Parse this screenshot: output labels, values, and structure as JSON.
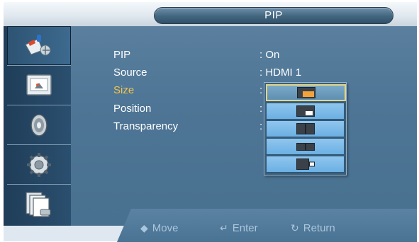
{
  "header": {
    "title": "PIP"
  },
  "sidebar": {
    "items": [
      {
        "name": "input-icon",
        "active": true
      },
      {
        "name": "picture-icon",
        "active": false
      },
      {
        "name": "sound-icon",
        "active": false
      },
      {
        "name": "setup-icon",
        "active": false
      },
      {
        "name": "multi-control-icon",
        "active": false
      }
    ]
  },
  "menu": {
    "rows": [
      {
        "label": "PIP",
        "value": ": On"
      },
      {
        "label": "Source",
        "value": ": HDMI 1"
      },
      {
        "label": "Size",
        "value": ":"
      },
      {
        "label": "Position",
        "value": ":"
      },
      {
        "label": "Transparency",
        "value": ":"
      }
    ],
    "highlighted_row": "Size"
  },
  "size_dropdown": {
    "options": [
      {
        "name": "size-large-inset-icon",
        "selected": true
      },
      {
        "name": "size-small-inset-icon",
        "selected": false
      },
      {
        "name": "size-split-icon",
        "selected": false
      },
      {
        "name": "size-split-wide-icon",
        "selected": false
      },
      {
        "name": "size-side-inset-icon",
        "selected": false
      }
    ]
  },
  "footer": {
    "move": "Move",
    "enter": "Enter",
    "return": "Return"
  },
  "colors": {
    "highlight": "#f3c44a",
    "panel": "#4e7595",
    "hint_text": "#a9c6dc"
  }
}
